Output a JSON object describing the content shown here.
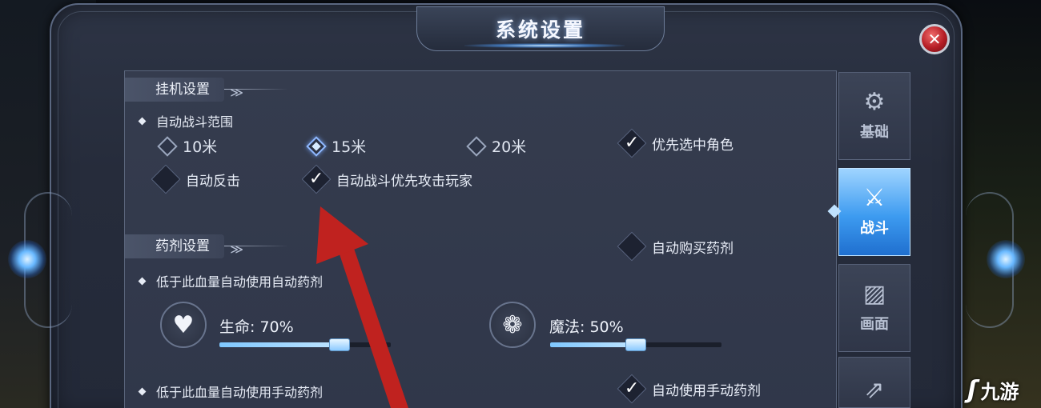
{
  "dialog": {
    "title": "系统设置",
    "close_icon": "close-icon"
  },
  "idle": {
    "section_label": "挂机设置",
    "range_label": "自动战斗范围",
    "ranges": [
      {
        "label": "10米",
        "selected": false
      },
      {
        "label": "15米",
        "selected": true
      },
      {
        "label": "20米",
        "selected": false
      }
    ],
    "prioritize_selected": {
      "label": "优先选中角色",
      "checked": true
    },
    "auto_counter": {
      "label": "自动反击",
      "checked": false
    },
    "prioritize_players": {
      "label": "自动战斗优先攻击玩家",
      "checked": true
    }
  },
  "potion": {
    "section_label": "药剂设置",
    "auto_buy": {
      "label": "自动购买药剂",
      "checked": false
    },
    "auto_threshold_label": "低于此血量自动使用自动药剂",
    "hp": {
      "label": "生命:",
      "value": "70%",
      "percent": 70
    },
    "mp": {
      "label": "魔法:",
      "value": "50%",
      "percent": 50
    },
    "manual_threshold_label": "低于此血量自动使用手动药剂",
    "auto_manual": {
      "label": "自动使用手动药剂",
      "checked": true
    }
  },
  "sidebar": {
    "tabs": [
      {
        "label": "基础",
        "icon": "gear-icon",
        "active": false
      },
      {
        "label": "战斗",
        "icon": "sword-shield-icon",
        "active": true
      },
      {
        "label": "画面",
        "icon": "image-icon",
        "active": false
      },
      {
        "label": "",
        "icon": "share-icon",
        "active": false
      }
    ]
  },
  "watermark": {
    "text": "九游"
  },
  "colors": {
    "accent": "#3d9bf0",
    "close": "#b51d25",
    "arrow": "#c0221f"
  }
}
